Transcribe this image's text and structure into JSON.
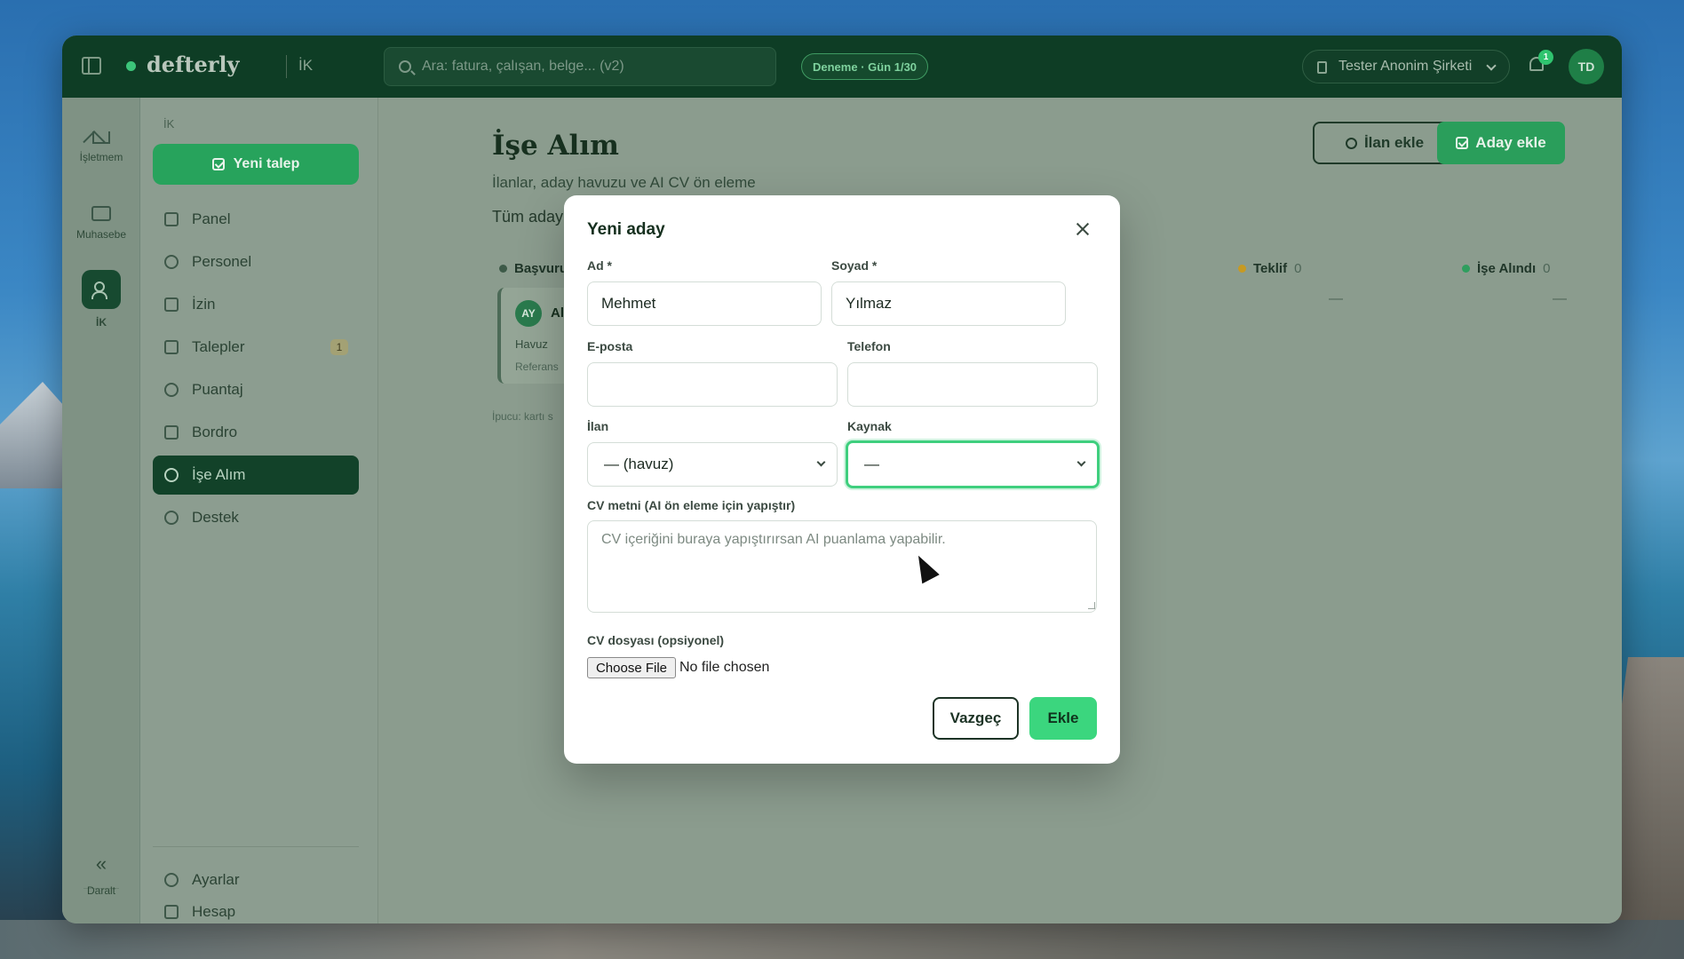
{
  "topbar": {
    "brand": "defterly",
    "module": "İK",
    "search_placeholder": "Ara: fatura, çalışan, belge... (v2)",
    "trial_badge": "Deneme · Gün 1/30",
    "company": "Tester Anonim Şirketi",
    "notifications": "1",
    "user_initials": "TD"
  },
  "rail": {
    "items": [
      {
        "label": "İşletmem",
        "icon": "home-icon"
      },
      {
        "label": "Muhasebe",
        "icon": "folder-icon"
      },
      {
        "label": "İK",
        "icon": "people-icon"
      }
    ],
    "collapse_label": "Daralt"
  },
  "sidebar": {
    "section": "İK",
    "new_request": "Yeni talep",
    "items": [
      {
        "label": "Panel",
        "icon": "grid-icon"
      },
      {
        "label": "Personel",
        "icon": "people-icon"
      },
      {
        "label": "İzin",
        "icon": "calendar-icon"
      },
      {
        "label": "Talepler",
        "icon": "check-square-icon",
        "badge": "1"
      },
      {
        "label": "Puantaj",
        "icon": "clock-icon"
      },
      {
        "label": "Bordro",
        "icon": "card-icon"
      },
      {
        "label": "İşe Alım",
        "icon": "search-icon",
        "active": true
      },
      {
        "label": "Destek",
        "icon": "chat-icon"
      }
    ],
    "bottom": [
      {
        "label": "Ayarlar",
        "icon": "gear-icon"
      },
      {
        "label": "Hesap",
        "icon": "building-icon"
      }
    ]
  },
  "main": {
    "title": "İşe Alım",
    "subtitle": "İlanlar, aday havuzu ve AI CV ön eleme",
    "tab_label": "Tüm aday",
    "add_listing": "İlan ekle",
    "add_candidate": "Aday ekle",
    "columns": [
      {
        "label": "Başvuru",
        "color": "#3d5a48",
        "count": ""
      },
      {
        "label": "Teklif",
        "color": "#c79a22",
        "count": "0",
        "empty": "—"
      },
      {
        "label": "İşe Alındı",
        "color": "#2f9e5e",
        "count": "0",
        "empty": "—"
      }
    ],
    "card": {
      "initials": "AY",
      "name": "Al",
      "pool": "Havuz",
      "ref": "Referans"
    },
    "tip": "İpucu: kartı s"
  },
  "modal": {
    "title": "Yeni aday",
    "first_name_label": "Ad *",
    "first_name_value": "Mehmet",
    "last_name_label": "Soyad *",
    "last_name_value": "Yılmaz",
    "email_label": "E-posta",
    "email_value": "",
    "phone_label": "Telefon",
    "phone_value": "",
    "listing_label": "İlan",
    "listing_value": "— (havuz)",
    "source_label": "Kaynak",
    "source_value": "—",
    "cv_text_label": "CV metni (AI ön eleme için yapıştır)",
    "cv_text_placeholder": "CV içeriğini buraya yapıştırırsan AI puanlama yapabilir.",
    "cv_file_label": "CV dosyası (opsiyonel)",
    "choose_file": "Choose File",
    "file_status": "No file chosen",
    "cancel": "Vazgeç",
    "submit": "Ekle"
  }
}
